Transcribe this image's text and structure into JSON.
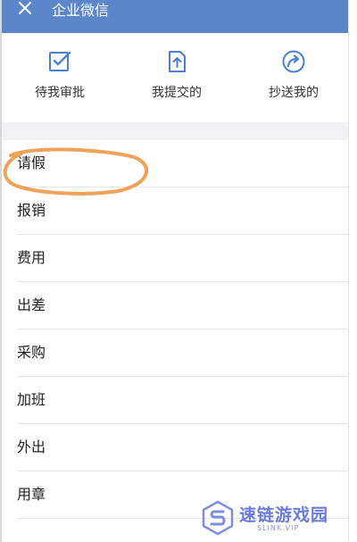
{
  "titlebar": {
    "title": "企业微信"
  },
  "actions": [
    {
      "label": "待我审批"
    },
    {
      "label": "我提交的"
    },
    {
      "label": "抄送我的"
    }
  ],
  "list": {
    "items": [
      {
        "label": "请假"
      },
      {
        "label": "报销"
      },
      {
        "label": "费用"
      },
      {
        "label": "出差"
      },
      {
        "label": "采购"
      },
      {
        "label": "加班"
      },
      {
        "label": "外出"
      },
      {
        "label": "用章"
      }
    ]
  },
  "watermark": {
    "main": "速链游戏园",
    "sub": "SLINK.VIP"
  },
  "colors": {
    "titlebar": "#5b86c9",
    "icon": "#4a7fd1",
    "annotation": "#f0a258",
    "watermark": "#6a7bd8"
  }
}
